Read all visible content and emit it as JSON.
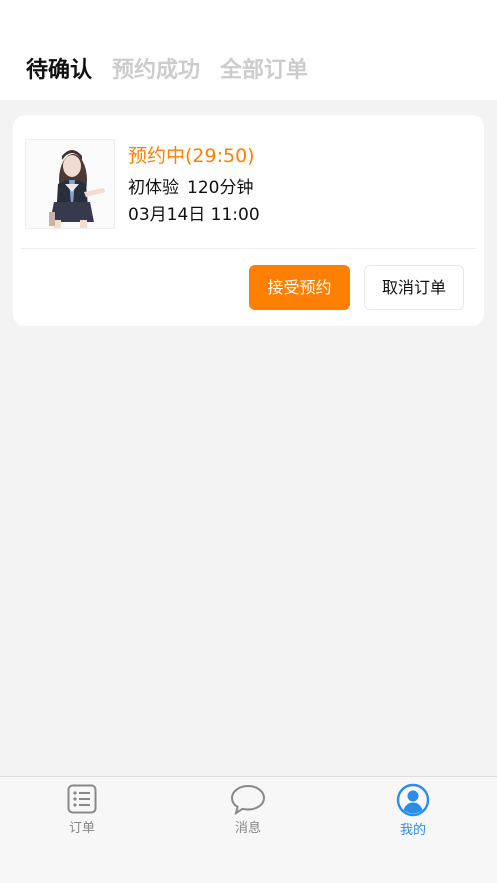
{
  "tabs": [
    {
      "label": "待确认",
      "active": true
    },
    {
      "label": "预约成功",
      "active": false
    },
    {
      "label": "全部订单",
      "active": false
    }
  ],
  "order": {
    "status": "预约中(29:50)",
    "service_name": "初体验",
    "duration": "120分钟",
    "datetime": "03月14日 11:00",
    "accept_label": "接受预约",
    "cancel_label": "取消订单"
  },
  "tabbar": {
    "items": [
      {
        "label": "订单",
        "icon": "list-icon"
      },
      {
        "label": "消息",
        "icon": "chat-bubble-icon"
      },
      {
        "label": "我的",
        "icon": "user-icon",
        "active": true
      }
    ]
  },
  "colors": {
    "accent": "#ff8000",
    "tab_active": "#2b8ee6",
    "background": "#f3f3f3"
  }
}
